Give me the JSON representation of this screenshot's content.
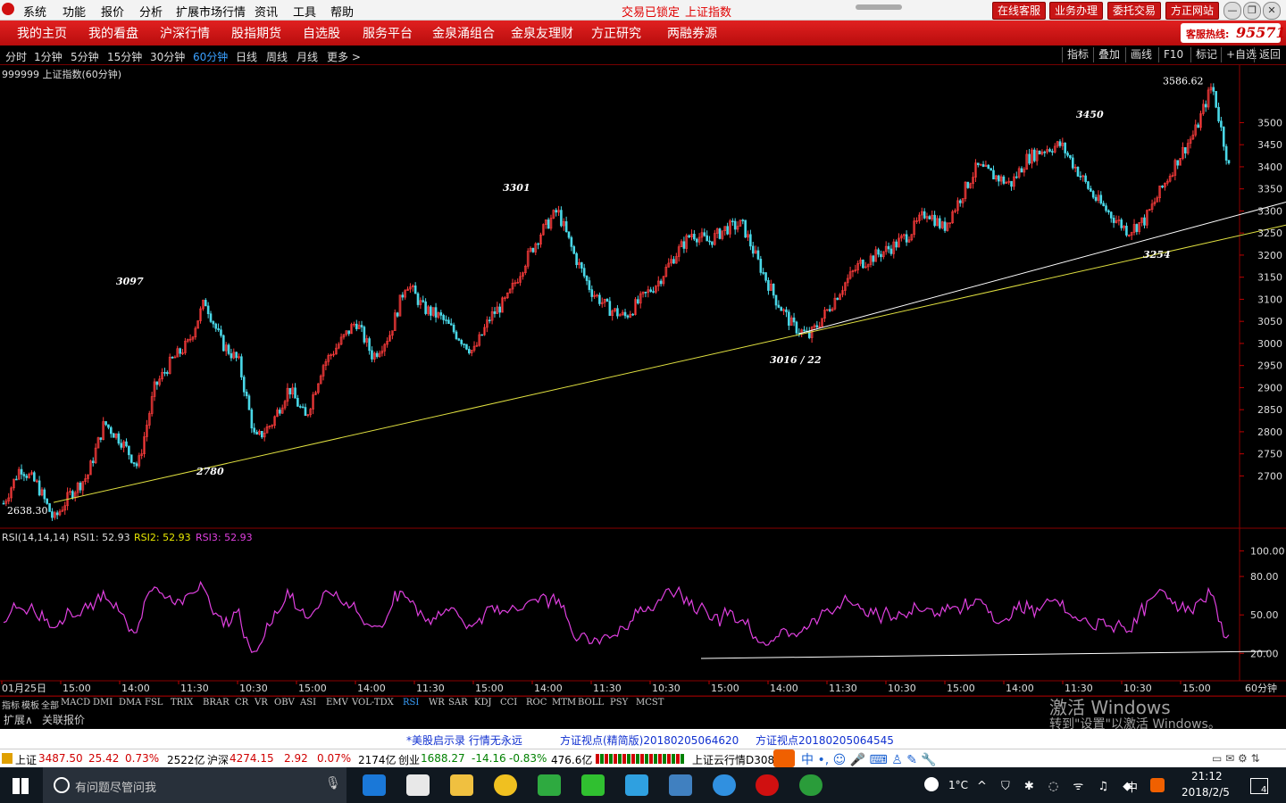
{
  "menu": [
    "系统",
    "功能",
    "报价",
    "分析",
    "扩展市场行情",
    "资讯",
    "工具",
    "帮助"
  ],
  "status": {
    "locked": "交易已锁定",
    "index": "上证指数"
  },
  "top_buttons": [
    "在线客服",
    "业务办理",
    "委托交易",
    "方正网站"
  ],
  "nav": [
    "我的主页",
    "我的看盘",
    "沪深行情",
    "股指期货",
    "自选股",
    "服务平台",
    "金泉涌组合",
    "金泉友理财",
    "方正研究",
    "两融券源"
  ],
  "hotline": {
    "label": "客服热线:",
    "number": "95571"
  },
  "periods": [
    "分时",
    "1分钟",
    "5分钟",
    "15分钟",
    "30分钟",
    "60分钟",
    "日线",
    "周线",
    "月线",
    "更多 >"
  ],
  "active_period": "60分钟",
  "right_buttons": [
    "指标",
    "叠加",
    "画线",
    "F10",
    "标记",
    "+自选",
    "返回"
  ],
  "chart_title": "999999 上证指数(60分钟)",
  "rsi_header": {
    "label": "RSI(14,14,14)",
    "rsi1": "RSI1: 52.93",
    "rsi2": "RSI2: 52.93",
    "rsi3": "RSI3: 52.93"
  },
  "x_axis_labels": [
    "01月25日",
    "15:00",
    "14:00",
    "11:30",
    "10:30",
    "15:00",
    "14:00",
    "11:30",
    "15:00",
    "14:00",
    "11:30",
    "10:30",
    "15:00",
    "14:00",
    "11:30",
    "10:30",
    "15:00",
    "14:00",
    "11:30",
    "10:30",
    "15:00"
  ],
  "period_corner": "60分钟",
  "indicator_tabs": [
    "指标",
    "模板",
    "全部",
    "MACD",
    "DMI",
    "DMA",
    "FSL",
    "TRIX",
    "BRAR",
    "CR",
    "VR",
    "OBV",
    "ASI",
    "EMV",
    "VOL-TDX",
    "RSI",
    "WR",
    "SAR",
    "KDJ",
    "CCI",
    "ROC",
    "MTM",
    "BOLL",
    "PSY",
    "MCST"
  ],
  "active_tab": "RSI",
  "ext_row": [
    "扩展∧",
    "关联报价"
  ],
  "news": [
    "*美股启示录  行情无永远",
    "方证视点(精简版)20180205064620",
    "方证视点20180205064545"
  ],
  "status_quotes": {
    "sh_label": "上证",
    "sh_value": "3487.50",
    "sh_change": "25.42",
    "sh_pct": "0.73%",
    "sh_vol": "2522亿",
    "hs_label": "沪深",
    "hs_value": "4274.15",
    "hs_change": "2.92",
    "hs_pct": "0.07%",
    "hs_vol": "2174亿",
    "cy_label": "创业",
    "cy_value": "1688.27",
    "cy_change": "-14.16",
    "cy_pct": "-0.83%",
    "cy_vol": "476.6亿",
    "cloud": "上证云行情D308"
  },
  "watermark": {
    "line1": "激活 Windows",
    "line2": "转到\"设置\"以激活 Windows。"
  },
  "taskbar": {
    "search_placeholder": "有问题尽管问我",
    "temp": "1°C",
    "ime": "中",
    "time": "21:12",
    "date": "2018/2/5",
    "notify": "4"
  },
  "chart_data": {
    "type": "candlestick",
    "title": "999999 上证指数(60分钟)",
    "y_ticks": [
      3500,
      3450,
      3400,
      3350,
      3300,
      3250,
      3200,
      3150,
      3100,
      3050,
      3000,
      2950,
      2900,
      2850,
      2800,
      2750,
      2700
    ],
    "ylim": [
      2620,
      3610
    ],
    "annotations": [
      {
        "text": "2638.30",
        "value": 2638.3
      },
      {
        "text": "3097",
        "value": 3097
      },
      {
        "text": "2780",
        "value": 2780
      },
      {
        "text": "3301",
        "value": 3301
      },
      {
        "text": "3016 / 22",
        "value": 3016
      },
      {
        "text": "3450",
        "value": 3450
      },
      {
        "text": "3254",
        "value": 3254
      },
      {
        "text": "3586.62",
        "value": 3586.62
      }
    ],
    "price_path": [
      2638,
      2720,
      2680,
      2600,
      2660,
      2700,
      2820,
      2780,
      2720,
      2900,
      2960,
      3000,
      3097,
      3000,
      2960,
      2780,
      2820,
      2900,
      2830,
      2950,
      3000,
      3050,
      2970,
      3020,
      3140,
      3080,
      3060,
      3020,
      2980,
      3060,
      3100,
      3180,
      3250,
      3301,
      3200,
      3120,
      3080,
      3060,
      3100,
      3140,
      3200,
      3250,
      3230,
      3260,
      3270,
      3180,
      3100,
      3040,
      3016,
      3070,
      3130,
      3180,
      3200,
      3220,
      3250,
      3300,
      3260,
      3330,
      3400,
      3380,
      3360,
      3420,
      3440,
      3450,
      3390,
      3330,
      3290,
      3254,
      3280,
      3350,
      3420,
      3480,
      3586,
      3400
    ],
    "rsi": {
      "ylim": [
        0,
        110
      ],
      "y_ticks": [
        100,
        80,
        50,
        20
      ],
      "last": 52.93
    }
  }
}
